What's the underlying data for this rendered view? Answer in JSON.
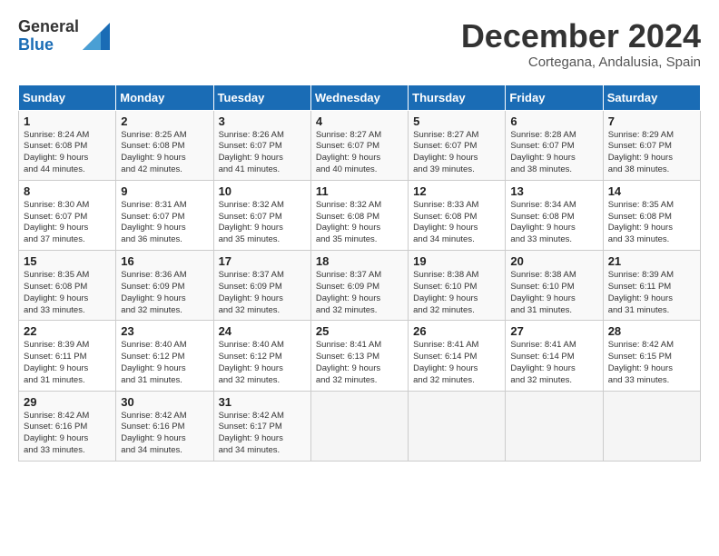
{
  "logo": {
    "general": "General",
    "blue": "Blue"
  },
  "title": "December 2024",
  "subtitle": "Cortegana, Andalusia, Spain",
  "weekdays": [
    "Sunday",
    "Monday",
    "Tuesday",
    "Wednesday",
    "Thursday",
    "Friday",
    "Saturday"
  ],
  "weeks": [
    [
      {
        "day": "1",
        "sunrise": "8:24 AM",
        "sunset": "6:08 PM",
        "daylight": "9 hours and 44 minutes."
      },
      {
        "day": "2",
        "sunrise": "8:25 AM",
        "sunset": "6:08 PM",
        "daylight": "9 hours and 42 minutes."
      },
      {
        "day": "3",
        "sunrise": "8:26 AM",
        "sunset": "6:07 PM",
        "daylight": "9 hours and 41 minutes."
      },
      {
        "day": "4",
        "sunrise": "8:27 AM",
        "sunset": "6:07 PM",
        "daylight": "9 hours and 40 minutes."
      },
      {
        "day": "5",
        "sunrise": "8:27 AM",
        "sunset": "6:07 PM",
        "daylight": "9 hours and 39 minutes."
      },
      {
        "day": "6",
        "sunrise": "8:28 AM",
        "sunset": "6:07 PM",
        "daylight": "9 hours and 38 minutes."
      },
      {
        "day": "7",
        "sunrise": "8:29 AM",
        "sunset": "6:07 PM",
        "daylight": "9 hours and 38 minutes."
      }
    ],
    [
      {
        "day": "8",
        "sunrise": "8:30 AM",
        "sunset": "6:07 PM",
        "daylight": "9 hours and 37 minutes."
      },
      {
        "day": "9",
        "sunrise": "8:31 AM",
        "sunset": "6:07 PM",
        "daylight": "9 hours and 36 minutes."
      },
      {
        "day": "10",
        "sunrise": "8:32 AM",
        "sunset": "6:07 PM",
        "daylight": "9 hours and 35 minutes."
      },
      {
        "day": "11",
        "sunrise": "8:32 AM",
        "sunset": "6:08 PM",
        "daylight": "9 hours and 35 minutes."
      },
      {
        "day": "12",
        "sunrise": "8:33 AM",
        "sunset": "6:08 PM",
        "daylight": "9 hours and 34 minutes."
      },
      {
        "day": "13",
        "sunrise": "8:34 AM",
        "sunset": "6:08 PM",
        "daylight": "9 hours and 33 minutes."
      },
      {
        "day": "14",
        "sunrise": "8:35 AM",
        "sunset": "6:08 PM",
        "daylight": "9 hours and 33 minutes."
      }
    ],
    [
      {
        "day": "15",
        "sunrise": "8:35 AM",
        "sunset": "6:08 PM",
        "daylight": "9 hours and 33 minutes."
      },
      {
        "day": "16",
        "sunrise": "8:36 AM",
        "sunset": "6:09 PM",
        "daylight": "9 hours and 32 minutes."
      },
      {
        "day": "17",
        "sunrise": "8:37 AM",
        "sunset": "6:09 PM",
        "daylight": "9 hours and 32 minutes."
      },
      {
        "day": "18",
        "sunrise": "8:37 AM",
        "sunset": "6:09 PM",
        "daylight": "9 hours and 32 minutes."
      },
      {
        "day": "19",
        "sunrise": "8:38 AM",
        "sunset": "6:10 PM",
        "daylight": "9 hours and 32 minutes."
      },
      {
        "day": "20",
        "sunrise": "8:38 AM",
        "sunset": "6:10 PM",
        "daylight": "9 hours and 31 minutes."
      },
      {
        "day": "21",
        "sunrise": "8:39 AM",
        "sunset": "6:11 PM",
        "daylight": "9 hours and 31 minutes."
      }
    ],
    [
      {
        "day": "22",
        "sunrise": "8:39 AM",
        "sunset": "6:11 PM",
        "daylight": "9 hours and 31 minutes."
      },
      {
        "day": "23",
        "sunrise": "8:40 AM",
        "sunset": "6:12 PM",
        "daylight": "9 hours and 31 minutes."
      },
      {
        "day": "24",
        "sunrise": "8:40 AM",
        "sunset": "6:12 PM",
        "daylight": "9 hours and 32 minutes."
      },
      {
        "day": "25",
        "sunrise": "8:41 AM",
        "sunset": "6:13 PM",
        "daylight": "9 hours and 32 minutes."
      },
      {
        "day": "26",
        "sunrise": "8:41 AM",
        "sunset": "6:14 PM",
        "daylight": "9 hours and 32 minutes."
      },
      {
        "day": "27",
        "sunrise": "8:41 AM",
        "sunset": "6:14 PM",
        "daylight": "9 hours and 32 minutes."
      },
      {
        "day": "28",
        "sunrise": "8:42 AM",
        "sunset": "6:15 PM",
        "daylight": "9 hours and 33 minutes."
      }
    ],
    [
      {
        "day": "29",
        "sunrise": "8:42 AM",
        "sunset": "6:16 PM",
        "daylight": "9 hours and 33 minutes."
      },
      {
        "day": "30",
        "sunrise": "8:42 AM",
        "sunset": "6:16 PM",
        "daylight": "9 hours and 34 minutes."
      },
      {
        "day": "31",
        "sunrise": "8:42 AM",
        "sunset": "6:17 PM",
        "daylight": "9 hours and 34 minutes."
      },
      null,
      null,
      null,
      null
    ]
  ]
}
